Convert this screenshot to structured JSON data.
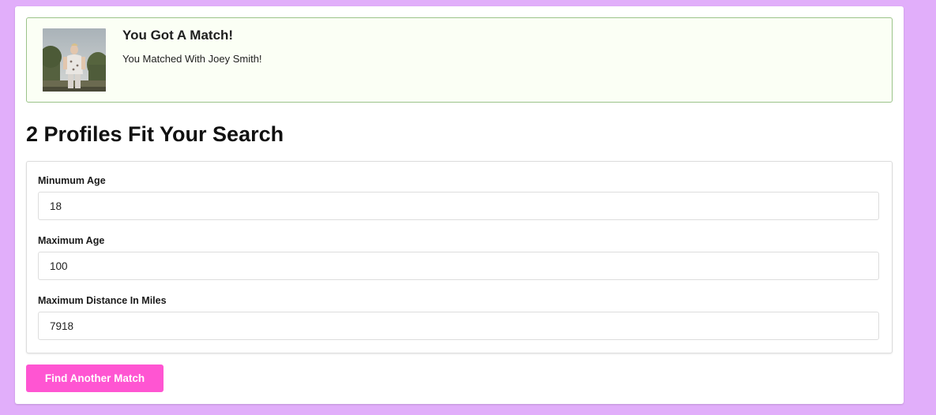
{
  "match": {
    "title": "You Got A Match!",
    "message": "You Matched With Joey Smith!",
    "photo_icon": "profile-photo"
  },
  "results": {
    "heading": "2 Profiles Fit Your Search"
  },
  "filters": {
    "min_age": {
      "label": "Minumum Age",
      "value": "18"
    },
    "max_age": {
      "label": "Maximum Age",
      "value": "100"
    },
    "max_distance": {
      "label": "Maximum Distance In Miles",
      "value": "7918"
    }
  },
  "actions": {
    "find_label": "Find Another Match"
  },
  "colors": {
    "page_background": "#e1aefa",
    "match_border": "#9bc38a",
    "button_background": "#ff55d2"
  }
}
